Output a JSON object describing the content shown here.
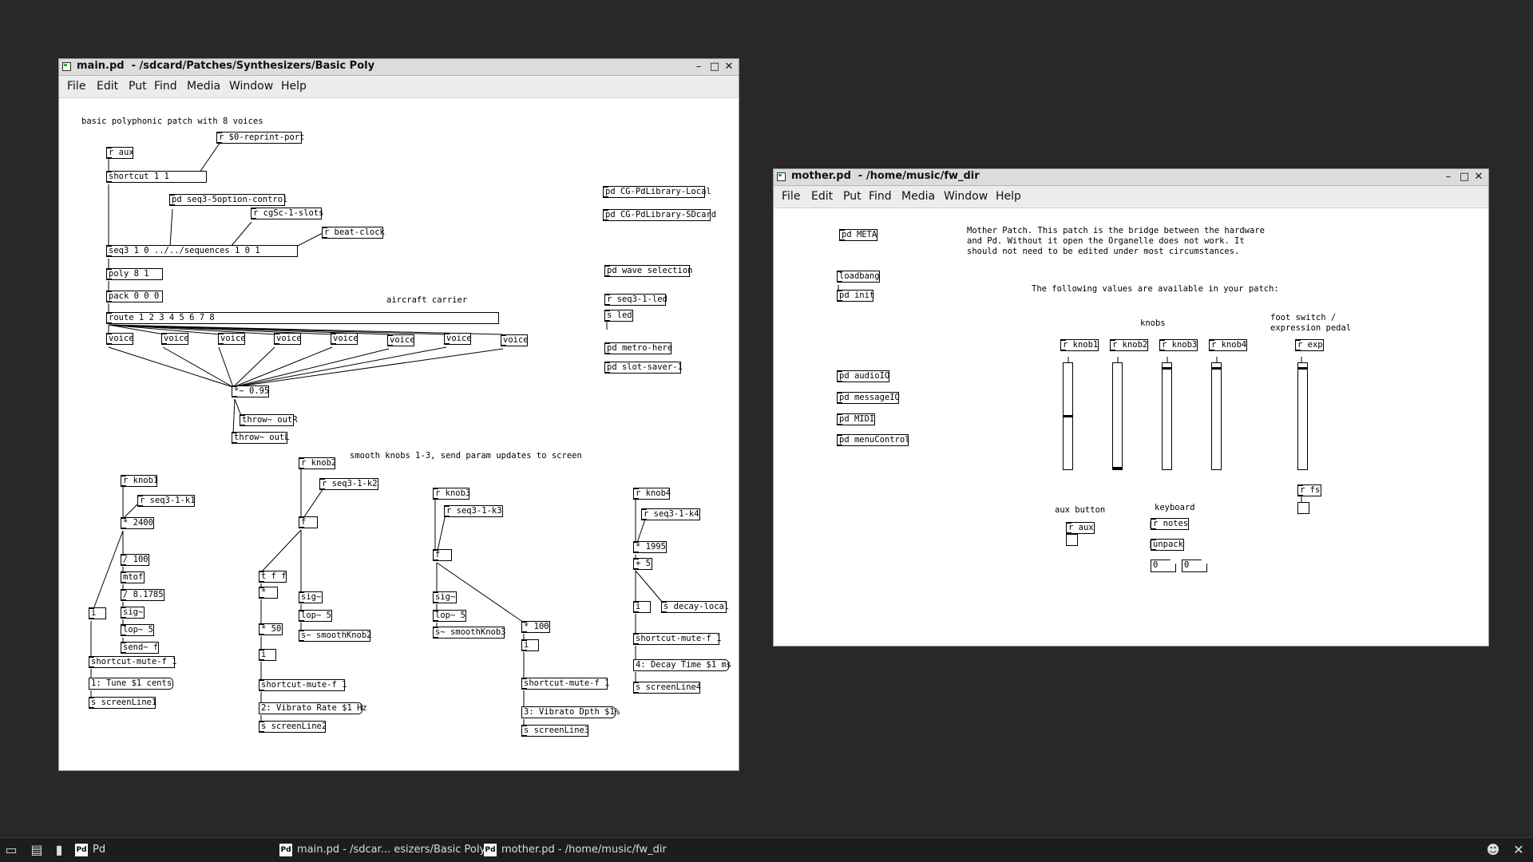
{
  "main_window": {
    "title": "main.pd  - /sdcard/Patches/Synthesizers/Basic Poly",
    "menu": [
      "File",
      "Edit",
      "Put",
      "Find",
      "Media",
      "Window",
      "Help"
    ],
    "comments": [
      "basic polyphonic patch with 8 voices",
      "aircraft carrier",
      "smooth knobs 1-3, send param updates to screen"
    ],
    "objects": [
      "r aux",
      "r $0-reprint-port",
      "shortcut 1 1",
      "pd seq3-5option-control",
      "r cgSc-1-slots",
      "r beat-clock",
      "seq3 1 0 ../../sequences 1 0 1",
      "poly 8 1",
      "pack 0 0 0",
      "route 1 2 3 4 5 6 7 8",
      "voice",
      "*~ 0.95",
      "throw~ outR",
      "throw~ outL",
      "pd CG-PdLibrary-Local",
      "pd CG-PdLibrary-SDcard",
      "pd wave selection",
      "r seq3-1-led",
      "s led",
      "pd metro-here",
      "pd slot-saver-1",
      "r knob1",
      "r seq3-1-k1",
      "* 2400",
      "/ 100",
      "mtof",
      "/ 8.1785",
      "sig~",
      "lop~ 5",
      "send~ f",
      "i",
      "shortcut-mute-f 1",
      "s screenLine1",
      "r knob2",
      "r seq3-1-k2",
      "f",
      "t f f",
      "*",
      "* 50",
      "s~ smoothKnob2",
      "s screenLine2",
      "r knob3",
      "r seq3-1-k3",
      "s~ smoothKnob3",
      "* 100",
      "s screenLine3",
      "r knob4",
      "r seq3-1-k4",
      "* 1995",
      "+ 5",
      "s decay-local",
      "s screenLine4"
    ],
    "messages": [
      "1: Tune $1 cents",
      "2: Vibrato Rate $1 Hz",
      "3: Vibrato Dpth $1%",
      "4: Decay Time $1 ms"
    ]
  },
  "mother_window": {
    "title": "mother.pd  - /home/music/fw_dir",
    "menu": [
      "File",
      "Edit",
      "Put",
      "Find",
      "Media",
      "Window",
      "Help"
    ],
    "description": [
      "Mother Patch. This patch is the bridge between the hardware",
      "and Pd. Without it open the Organelle does not work. It",
      "should not need to be edited under most circumstances."
    ],
    "values_note": "The following values are available in your patch:",
    "labels": [
      "knobs",
      "foot switch /",
      "expression pedal",
      "aux button",
      "keyboard"
    ],
    "objects": [
      "pd META",
      "loadbang",
      "pd init",
      "pd audioIO",
      "pd messageIO",
      "pd MIDI",
      "pd menuControl",
      "r knob1",
      "r knob2",
      "r knob3",
      "r knob4",
      "r exp",
      "r fs",
      "r aux",
      "r notes",
      "unpack"
    ],
    "number_boxes": [
      "0",
      "0"
    ],
    "slider_levels": [
      0.5,
      0.0,
      0.96,
      0.96,
      0.96
    ],
    "slider_names": [
      "knob1",
      "knob2",
      "knob3",
      "knob4",
      "exp"
    ]
  },
  "taskbar": {
    "launcher_label": "Pd",
    "tasks": [
      "main.pd  - /sdcar... esizers/Basic Poly",
      "mother.pd  - /home/music/fw_dir"
    ]
  },
  "colors": {
    "desktop": "#282828",
    "window_bg": "#ffffff",
    "titlebar": "#dcdcdc",
    "taskbar": "#1d1d1d"
  }
}
